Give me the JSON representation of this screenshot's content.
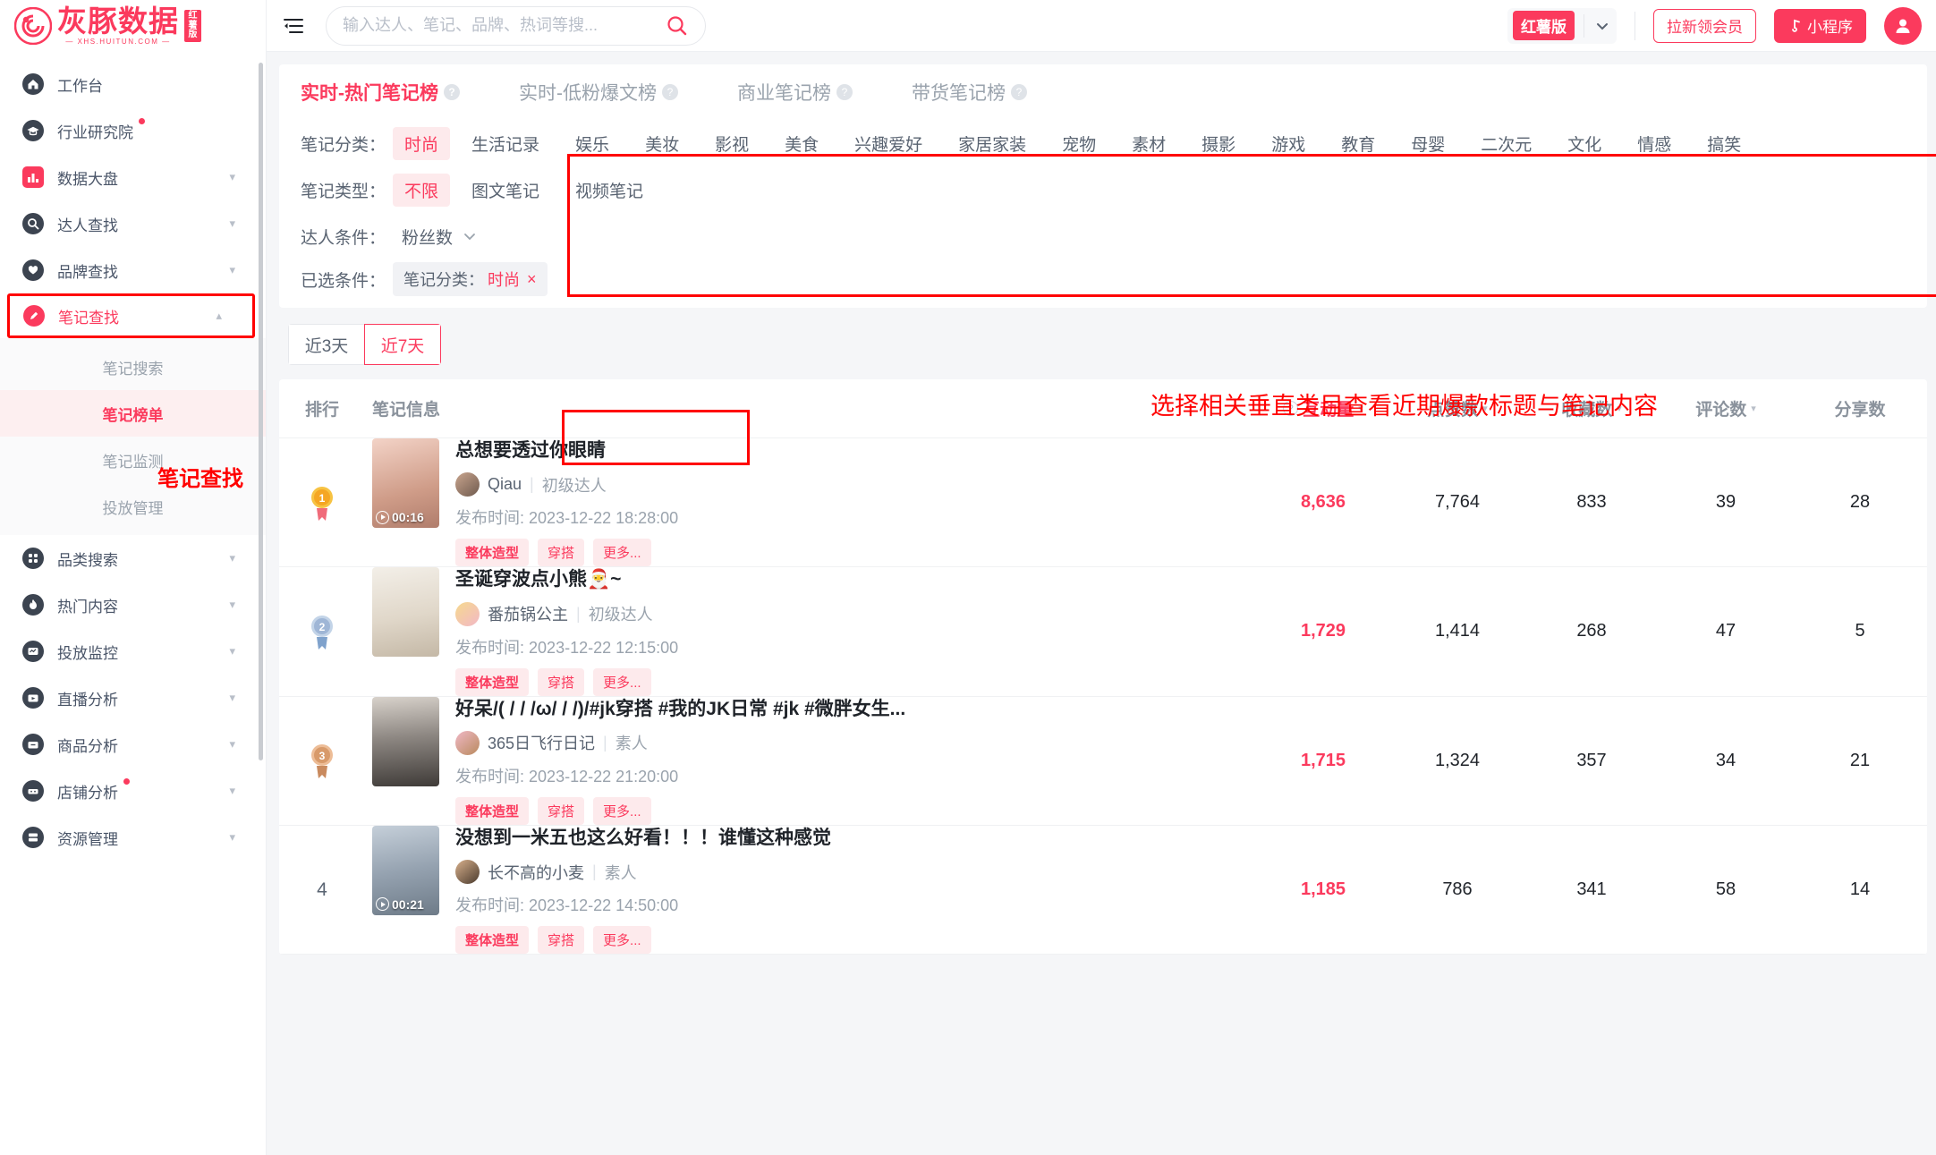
{
  "brand": {
    "logo_text": "灰豚数据",
    "logo_sub": "— XHS.HUITUN.COM —",
    "logo_badge": "红薯版"
  },
  "topbar": {
    "collapse_icon": "collapse-menu-icon",
    "search_placeholder": "输入达人、笔记、品牌、热词等搜...",
    "search_value": "",
    "search_icon": "search-icon",
    "version_tag": "红薯版",
    "version_chevron": "chevron-down-icon",
    "invite_button": "拉新领会员",
    "miniapp_button": "小程序",
    "miniapp_icon": "music-note-icon",
    "avatar": "user-avatar-icon"
  },
  "sidebar": {
    "items": [
      {
        "label": "工作台",
        "icon": "home-icon",
        "dot": false,
        "chevron": false
      },
      {
        "label": "行业研究院",
        "icon": "graduation-cap-icon",
        "dot": true,
        "chevron": false
      },
      {
        "label": "数据大盘",
        "icon": "bar-chart-icon",
        "dot": false,
        "chevron": true
      },
      {
        "label": "达人查找",
        "icon": "search-circle-icon",
        "dot": false,
        "chevron": true
      },
      {
        "label": "品牌查找",
        "icon": "heart-circle-icon",
        "dot": false,
        "chevron": true
      },
      {
        "label": "笔记查找",
        "icon": "pencil-circle-icon",
        "dot": false,
        "chevron": true,
        "active": true
      },
      {
        "label": "品类搜索",
        "icon": "grid-circle-icon",
        "dot": false,
        "chevron": true
      },
      {
        "label": "热门内容",
        "icon": "flame-circle-icon",
        "dot": false,
        "chevron": true
      },
      {
        "label": "投放监控",
        "icon": "monitor-circle-icon",
        "dot": false,
        "chevron": true
      },
      {
        "label": "直播分析",
        "icon": "live-circle-icon",
        "dot": false,
        "chevron": true
      },
      {
        "label": "商品分析",
        "icon": "bag-circle-icon",
        "dot": false,
        "chevron": true
      },
      {
        "label": "店铺分析",
        "icon": "shop-circle-icon",
        "dot": true,
        "chevron": true
      },
      {
        "label": "资源管理",
        "icon": "server-circle-icon",
        "dot": false,
        "chevron": true
      }
    ],
    "sub_items": [
      {
        "label": "笔记搜索",
        "selected": false
      },
      {
        "label": "笔记榜单",
        "selected": true
      },
      {
        "label": "笔记监测",
        "selected": false
      },
      {
        "label": "投放管理",
        "selected": false
      }
    ],
    "annotation": "笔记查找"
  },
  "annotations": {
    "main": "选择相关垂直类目查看近期爆款标题与笔记内容"
  },
  "tabs": [
    {
      "label": "实时-热门笔记榜",
      "active": true,
      "help": "?"
    },
    {
      "label": "实时-低粉爆文榜",
      "active": false,
      "help": "?"
    },
    {
      "label": "商业笔记榜",
      "active": false,
      "help": "?"
    },
    {
      "label": "带货笔记榜",
      "active": false,
      "help": "?"
    }
  ],
  "filters": {
    "category_label": "笔记分类：",
    "categories": [
      "时尚",
      "生活记录",
      "娱乐",
      "美妆",
      "影视",
      "美食",
      "兴趣爱好",
      "家居家装",
      "宠物",
      "素材",
      "摄影",
      "游戏",
      "教育",
      "母婴",
      "二次元",
      "文化",
      "情感",
      "搞笑"
    ],
    "category_selected": "时尚",
    "type_label": "笔记类型：",
    "types": [
      "不限",
      "图文笔记",
      "视频笔记"
    ],
    "type_selected": "不限",
    "creator_label": "达人条件：",
    "creator_dropdown": "粉丝数",
    "creator_chevron": "chevron-down-icon",
    "selected_label": "已选条件：",
    "selected_chip_key": "笔记分类：",
    "selected_chip_value": "时尚",
    "selected_chip_close": "×"
  },
  "date_range": {
    "options": [
      {
        "label": "近3天",
        "on": false
      },
      {
        "label": "近7天",
        "on": true
      }
    ]
  },
  "table": {
    "headers": {
      "rank": "排行",
      "info": "笔记信息",
      "interaction": "互动量",
      "likes": "点赞数",
      "collects": "收藏数",
      "comments": "评论数",
      "shares": "分享数"
    },
    "rows": [
      {
        "rank": "1",
        "medal": true,
        "medal_color": "#f5a623",
        "title": "总想要透过你眼睛",
        "author": "Qiau",
        "level": "初级达人",
        "publish_prefix": "发布时间:",
        "publish_time": "2023-12-22 18:28:00",
        "tags": [
          "整体造型",
          "穿搭",
          "更多..."
        ],
        "duration": "00:16",
        "has_video": true,
        "interaction": "8,636",
        "likes": "7,764",
        "collects": "833",
        "comments": "39",
        "shares": "28",
        "thumb_a": "#f0cfc4",
        "thumb_b": "#d9a894"
      },
      {
        "rank": "2",
        "medal": true,
        "medal_color": "#9fb6d6",
        "title": "圣诞穿波点小熊🎅~",
        "author": "番茄锅公主",
        "level": "初级达人",
        "publish_prefix": "发布时间:",
        "publish_time": "2023-12-22 12:15:00",
        "tags": [
          "整体造型",
          "穿搭",
          "更多..."
        ],
        "duration": "",
        "has_video": false,
        "interaction": "1,729",
        "likes": "1,414",
        "collects": "268",
        "comments": "47",
        "shares": "5",
        "thumb_a": "#efe7dd",
        "thumb_b": "#cfc2b0"
      },
      {
        "rank": "3",
        "medal": true,
        "medal_color": "#d89a6a",
        "title": "好呆/( / / /ω/ / /)/#jk穿搭 #我的JK日常 #jk #微胖女生...",
        "author": "365日飞行日记",
        "level": "素人",
        "publish_prefix": "发布时间:",
        "publish_time": "2023-12-22 21:20:00",
        "tags": [
          "整体造型",
          "穿搭",
          "更多..."
        ],
        "duration": "",
        "has_video": false,
        "interaction": "1,715",
        "likes": "1,324",
        "collects": "357",
        "comments": "34",
        "shares": "21",
        "thumb_a": "#cfc9c2",
        "thumb_b": "#57524e"
      },
      {
        "rank": "4",
        "medal": false,
        "medal_color": "",
        "title": "没想到一米五也这么好看！！！谁懂这种感觉",
        "author": "长不高的小麦",
        "level": "素人",
        "publish_prefix": "发布时间:",
        "publish_time": "2023-12-22 14:50:00",
        "tags": [
          "整体造型",
          "穿搭",
          "更多..."
        ],
        "duration": "00:21",
        "has_video": true,
        "interaction": "1,185",
        "likes": "786",
        "collects": "341",
        "comments": "58",
        "shares": "14",
        "thumb_a": "#b8c2cc",
        "thumb_b": "#7e8b99"
      }
    ]
  }
}
